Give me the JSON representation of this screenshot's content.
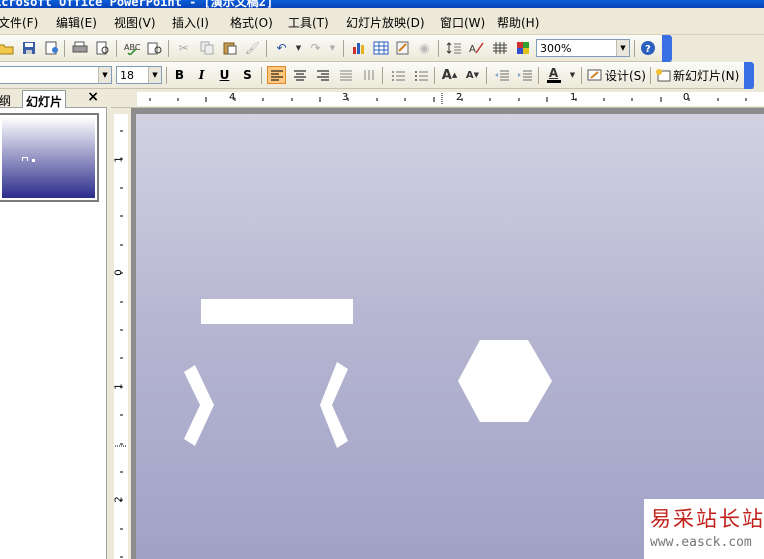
{
  "title_bar": {
    "text": "icrosoft Office PowerPoint - [演示文稿2]"
  },
  "menu": {
    "items": [
      "文件(F)",
      "编辑(E)",
      "视图(V)",
      "插入(I)",
      "格式(O)",
      "工具(T)",
      "幻灯片放映(D)",
      "窗口(W)",
      "帮助(H)"
    ]
  },
  "standard_toolbar": {
    "zoom_value": "300%"
  },
  "formatting_toolbar": {
    "font_size": "18",
    "bold_label": "B",
    "italic_label": "I",
    "underline_label": "U",
    "shadow_label": "S",
    "design_label": "设计(S)",
    "new_slide_label": "新幻灯片(N)"
  },
  "side_pane": {
    "outline_tab": "纲",
    "slides_tab": "幻灯片",
    "close_label": "×"
  },
  "ruler": {
    "horizontal_numbers": [
      "4",
      "3",
      "2",
      "1",
      "0"
    ],
    "vertical_numbers": [
      "1",
      "0",
      "1",
      "2"
    ]
  },
  "colors": {
    "slide_top": "#d2d2e2",
    "slide_bottom": "#a0a0c6",
    "shape_fill": "#ffffff",
    "title_bar": "#0a5ed9",
    "active_button": "#ffc87e"
  },
  "watermark": {
    "title": "易采站长站",
    "url": "www.easck.com"
  }
}
